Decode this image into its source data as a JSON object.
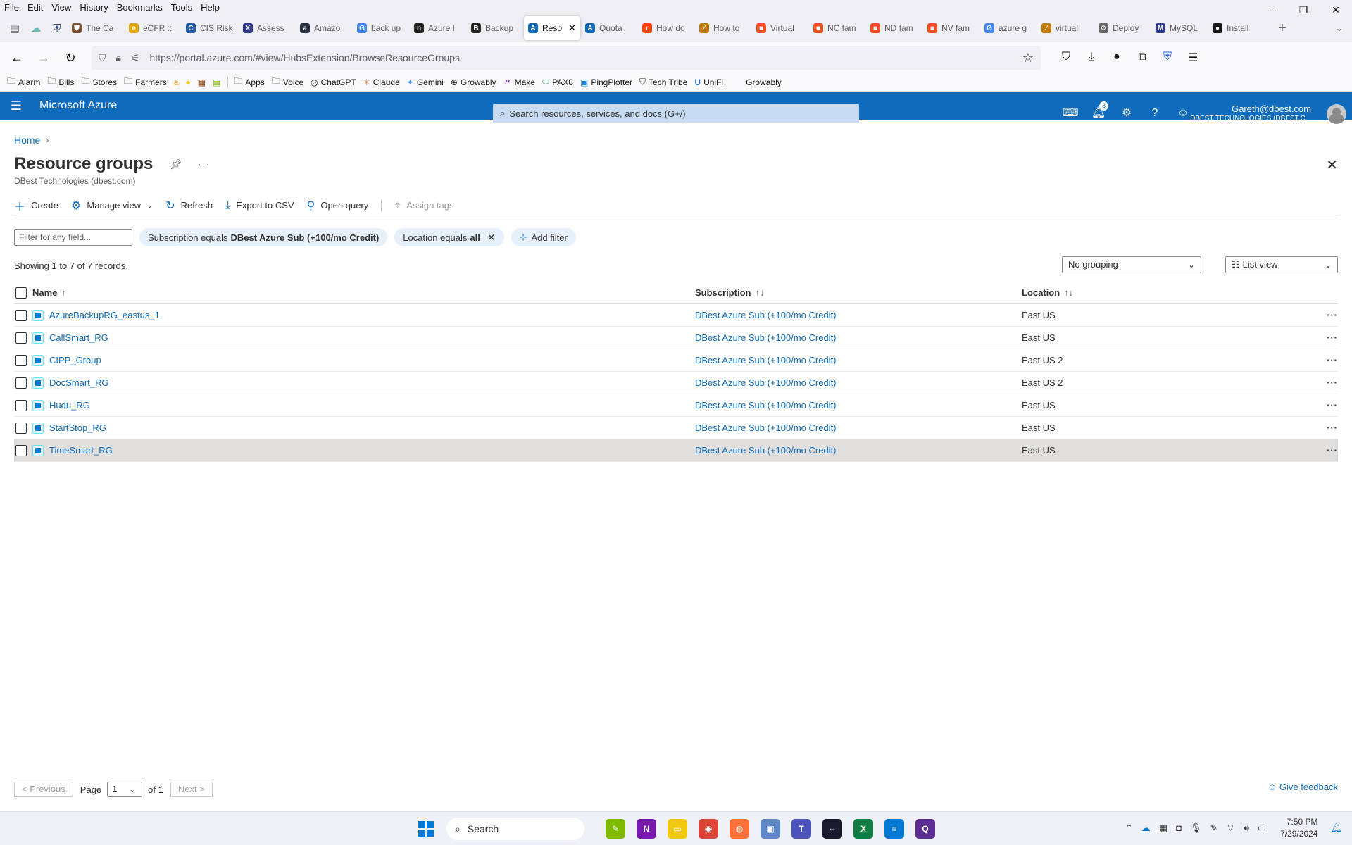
{
  "browser": {
    "menu": [
      "File",
      "Edit",
      "View",
      "History",
      "Bookmarks",
      "Tools",
      "Help"
    ],
    "window_controls": {
      "minimize": "–",
      "maximize": "❐",
      "close": "✕"
    },
    "tabs": [
      {
        "title": "The Ca",
        "color": "#7a5230",
        "glyph": "⛊"
      },
      {
        "title": "eCFR ::",
        "color": "#e0a800",
        "glyph": "e"
      },
      {
        "title": "CIS Risk",
        "color": "#1f5aa6",
        "glyph": "C"
      },
      {
        "title": "Assess",
        "color": "#2d3a8c",
        "glyph": "X"
      },
      {
        "title": "Amazo",
        "color": "#232f3e",
        "glyph": "a"
      },
      {
        "title": "back up",
        "color": "#4285f4",
        "glyph": "G"
      },
      {
        "title": "Azure I",
        "color": "#222222",
        "glyph": "n"
      },
      {
        "title": "Backup",
        "color": "#222222",
        "glyph": "B"
      },
      {
        "title": "Reso",
        "color": "#0f6cbd",
        "glyph": "A",
        "active": true
      },
      {
        "title": "Quota",
        "color": "#0f6cbd",
        "glyph": "A"
      },
      {
        "title": "How do",
        "color": "#ff4500",
        "glyph": "r"
      },
      {
        "title": "How to",
        "color": "#c17a00",
        "glyph": "⁄"
      },
      {
        "title": "Virtual",
        "color": "#f25022",
        "glyph": "■"
      },
      {
        "title": "NC fam",
        "color": "#f25022",
        "glyph": "■"
      },
      {
        "title": "ND fam",
        "color": "#f25022",
        "glyph": "■"
      },
      {
        "title": "NV fam",
        "color": "#f25022",
        "glyph": "■"
      },
      {
        "title": "azure g",
        "color": "#4285f4",
        "glyph": "G"
      },
      {
        "title": "virtual",
        "color": "#c17a00",
        "glyph": "⁄"
      },
      {
        "title": "Deploy",
        "color": "#666666",
        "glyph": "⚙"
      },
      {
        "title": "MySQL",
        "color": "#2d3a8c",
        "glyph": "M"
      },
      {
        "title": "Install",
        "color": "#181717",
        "glyph": "●"
      }
    ],
    "url": "https://portal.azure.com/#view/HubsExtension/BrowseResourceGroups",
    "bookmarks": [
      {
        "label": "Alarm",
        "icon": "folder-icon"
      },
      {
        "label": "Bills",
        "icon": "folder-icon"
      },
      {
        "label": "Stores",
        "icon": "folder-icon"
      },
      {
        "label": "Farmers",
        "icon": "folder-icon"
      },
      {
        "label": "Apps",
        "icon": "folder-icon"
      },
      {
        "label": "Voice",
        "icon": "folder-icon"
      },
      {
        "label": "ChatGPT",
        "icon": "chatgpt-icon"
      },
      {
        "label": "Claude",
        "icon": "claude-icon"
      },
      {
        "label": "Gemini",
        "icon": "gemini-icon"
      },
      {
        "label": "Growably",
        "icon": "globe-icon"
      },
      {
        "label": "Make",
        "icon": "make-icon"
      },
      {
        "label": "PAX8",
        "icon": "pax8-icon"
      },
      {
        "label": "PingPlotter",
        "icon": "pingplotter-icon"
      },
      {
        "label": "Tech Tribe",
        "icon": "techtribe-icon"
      },
      {
        "label": "UniFi",
        "icon": "unifi-icon"
      },
      {
        "label": "Growably",
        "icon": "none"
      }
    ]
  },
  "azure": {
    "brand": "Microsoft Azure",
    "search_placeholder": "Search resources, services, and docs (G+/)",
    "notifications_count": "3",
    "user_email": "Gareth@dbest.com",
    "user_tenant": "DBEST TECHNOLOGIES (DBEST.C..."
  },
  "page": {
    "breadcrumb_home": "Home",
    "title": "Resource groups",
    "subtitle": "DBest Technologies (dbest.com)",
    "commands": {
      "create": "Create",
      "manage_view": "Manage view",
      "refresh": "Refresh",
      "export_csv": "Export to CSV",
      "open_query": "Open query",
      "assign_tags": "Assign tags"
    },
    "filter_placeholder": "Filter for any field...",
    "filter_subscription_prefix": "Subscription equals",
    "filter_subscription_value": "DBest Azure Sub (+100/mo Credit)",
    "filter_location_prefix": "Location equals",
    "filter_location_value": "all",
    "add_filter": "Add filter",
    "records_text": "Showing 1 to 7 of 7 records.",
    "grouping": "No grouping",
    "view_mode": "List view",
    "columns": {
      "name": "Name",
      "subscription": "Subscription",
      "location": "Location"
    },
    "rows": [
      {
        "name": "AzureBackupRG_eastus_1",
        "subscription": "DBest Azure Sub (+100/mo Credit)",
        "location": "East US"
      },
      {
        "name": "CallSmart_RG",
        "subscription": "DBest Azure Sub (+100/mo Credit)",
        "location": "East US"
      },
      {
        "name": "CIPP_Group",
        "subscription": "DBest Azure Sub (+100/mo Credit)",
        "location": "East US 2"
      },
      {
        "name": "DocSmart_RG",
        "subscription": "DBest Azure Sub (+100/mo Credit)",
        "location": "East US 2"
      },
      {
        "name": "Hudu_RG",
        "subscription": "DBest Azure Sub (+100/mo Credit)",
        "location": "East US"
      },
      {
        "name": "StartStop_RG",
        "subscription": "DBest Azure Sub (+100/mo Credit)",
        "location": "East US"
      },
      {
        "name": "TimeSmart_RG",
        "subscription": "DBest Azure Sub (+100/mo Credit)",
        "location": "East US",
        "selected": true
      }
    ],
    "pager": {
      "previous": "< Previous",
      "page_label": "Page",
      "page_value": "1",
      "of_label": "of 1",
      "next": "Next >"
    },
    "feedback": "Give feedback"
  },
  "taskbar": {
    "search_label": "Search",
    "time": "7:50 PM",
    "date": "7/29/2024"
  }
}
